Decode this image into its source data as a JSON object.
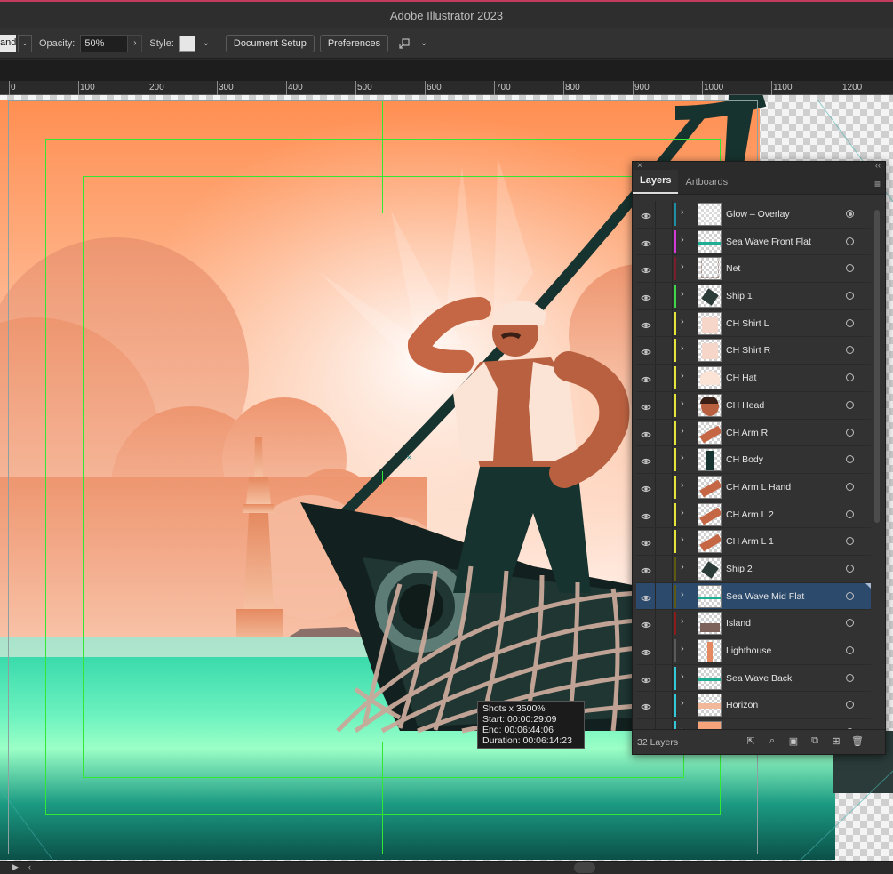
{
  "window": {
    "title": "Adobe Illustrator 2023"
  },
  "control_bar": {
    "mode_chip": "and",
    "opacity_label": "Opacity:",
    "opacity_value": "50%",
    "style_label": "Style:",
    "document_setup": "Document Setup",
    "preferences": "Preferences"
  },
  "ruler": {
    "labels": [
      "0",
      "100",
      "200",
      "300",
      "400",
      "500",
      "600",
      "700",
      "800",
      "900",
      "1000",
      "1100",
      "1200"
    ]
  },
  "tooltip": {
    "line1": "Shots x 3500%",
    "line2": "Start: 00:00:29:09",
    "line3": "End: 00:06:44:06",
    "line4": "Duration: 00:06:14:23"
  },
  "layers_panel": {
    "tabs": [
      "Layers",
      "Artboards"
    ],
    "count": "32 Layers",
    "layers": [
      {
        "name": "Glow – Overlay",
        "color": "#1f8ea5",
        "thumb": "glow"
      },
      {
        "name": "Sea Wave Front Flat",
        "color": "#d23ad6",
        "thumb": "wave"
      },
      {
        "name": "Net",
        "color": "#7c1d2b",
        "thumb": "net"
      },
      {
        "name": "Ship 1",
        "color": "#3fd44a",
        "thumb": "ship"
      },
      {
        "name": "CH Shirt L",
        "color": "#e4e43a",
        "thumb": "shirt"
      },
      {
        "name": "CH Shirt R",
        "color": "#e4e43a",
        "thumb": "shirt"
      },
      {
        "name": "CH Hat",
        "color": "#e4e43a",
        "thumb": "hat"
      },
      {
        "name": "CH Head",
        "color": "#e4e43a",
        "thumb": "head"
      },
      {
        "name": "CH Arm R",
        "color": "#e4e43a",
        "thumb": "arm"
      },
      {
        "name": "CH Body",
        "color": "#e4e43a",
        "thumb": "body"
      },
      {
        "name": "CH Arm L Hand",
        "color": "#e4e43a",
        "thumb": "arm"
      },
      {
        "name": "CH Arm L 2",
        "color": "#e4e43a",
        "thumb": "arm"
      },
      {
        "name": "CH Arm L 1",
        "color": "#e4e43a",
        "thumb": "arm"
      },
      {
        "name": "Ship 2",
        "color": "#5c5a12",
        "thumb": "ship"
      },
      {
        "name": "Sea Wave Mid Flat",
        "color": "#5c5a12",
        "thumb": "wave",
        "selected": true
      },
      {
        "name": "Island",
        "color": "#8a1c1c",
        "thumb": "island"
      },
      {
        "name": "Lighthouse",
        "color": "#5a5a5a",
        "thumb": "lighthouse"
      },
      {
        "name": "Sea Wave Back",
        "color": "#34c7d8",
        "thumb": "wave"
      },
      {
        "name": "Horizon",
        "color": "#34c7d8",
        "thumb": "horizon"
      },
      {
        "name": "",
        "color": "#34c7d8",
        "thumb": "sky"
      }
    ]
  }
}
